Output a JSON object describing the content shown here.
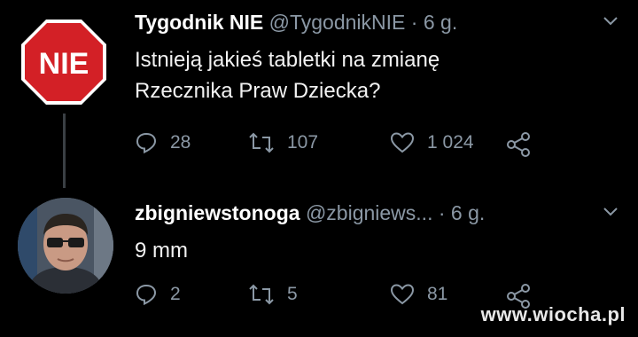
{
  "tweets": [
    {
      "author_name": "Tygodnik NIE",
      "handle": "@TygodnikNIE",
      "separator": "·",
      "time": "6 g.",
      "text_lines": [
        "Istnieją jakieś tabletki na zmianę",
        "Rzecznika Praw Dziecka?"
      ],
      "replies": "28",
      "retweets": "107",
      "likes": "1 024",
      "avatar_logo_text": "NIE"
    },
    {
      "author_name": "zbigniewstonoga",
      "handle": "@zbigniews...",
      "separator": "·",
      "time": "6 g.",
      "text_lines": [
        "9 mm"
      ],
      "replies": "2",
      "retweets": "5",
      "likes": "81"
    }
  ],
  "watermark": "www.wiocha.pl",
  "colors": {
    "background": "#000000",
    "muted": "#8b98a5",
    "stop_sign_red": "#d32026",
    "thread_line": "#3a3f44"
  }
}
